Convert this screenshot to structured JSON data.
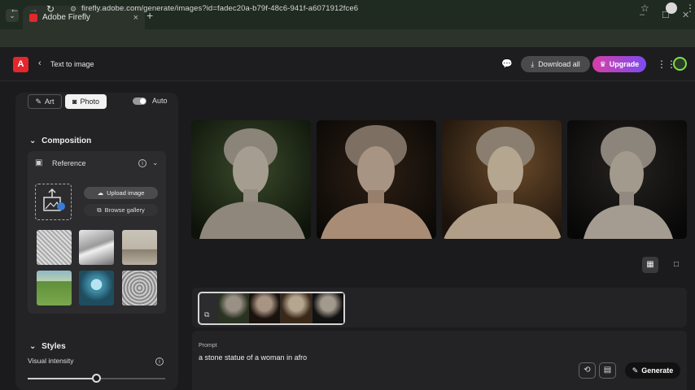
{
  "browser": {
    "tab_title": "Adobe Firefly",
    "tab_close": "×",
    "new_tab": "+",
    "tab_menu": "⌄",
    "url": "firefly.adobe.com/generate/images?id=fadec20a-b79f-48c6-941f-a6071912fce6",
    "win_min": "–",
    "win_max": "☐",
    "win_close": "✕"
  },
  "header": {
    "logo": "A",
    "breadcrumb": "Text to image",
    "download_all": "Download all",
    "upgrade": "Upgrade"
  },
  "panel": {
    "content_type": {
      "art": "Art",
      "photo": "Photo",
      "selected": "Photo"
    },
    "auto_label": "Auto",
    "composition": {
      "title": "Composition",
      "reference_label": "Reference",
      "upload_label": "Upload image",
      "browse_label": "Browse gallery",
      "gallery_thumbs": [
        "bird sketch",
        "abstract waves",
        "living room",
        "green field road",
        "blue sphere",
        "owl pattern"
      ]
    },
    "styles": {
      "title": "Styles",
      "visual_intensity_label": "Visual intensity",
      "visual_intensity": 0.5
    }
  },
  "results": {
    "images": [
      "statue-1",
      "statue-2",
      "statue-3",
      "statue-4"
    ]
  },
  "prompt": {
    "label": "Prompt",
    "text": "a stone statue of a woman in afro",
    "generate_label": "Generate"
  },
  "colors": {
    "accent_red": "#e4262d",
    "upgrade_gradient_start": "#d73ea6",
    "upgrade_gradient_end": "#7b4cf2",
    "avatar_ring": "#7ee04a"
  }
}
